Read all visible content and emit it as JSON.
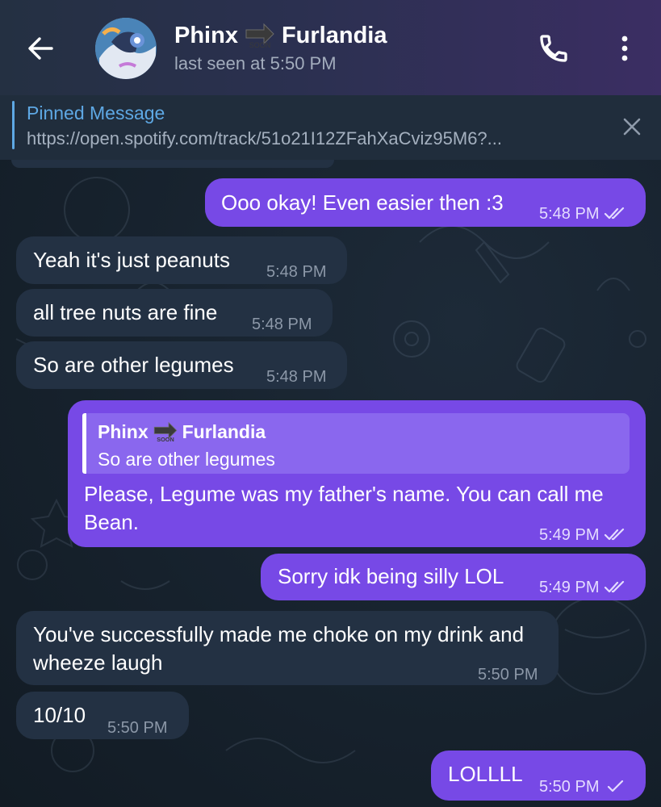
{
  "header": {
    "name_part1": "Phinx",
    "name_part2": "Furlandia",
    "soon_badge": "SOON",
    "status": "last seen at 5:50 PM"
  },
  "pinned": {
    "title": "Pinned Message",
    "text": "https://open.spotify.com/track/51o21I12ZFahXaCviz95M6?..."
  },
  "messages": [
    {
      "id": 1,
      "direction": "out",
      "text": "Ooo okay! Even easier then :3",
      "time": "5:48 PM",
      "status": "read"
    },
    {
      "id": 2,
      "direction": "in",
      "text": "Yeah it's just peanuts",
      "time": "5:48 PM"
    },
    {
      "id": 3,
      "direction": "in",
      "text": "all tree nuts are fine",
      "time": "5:48 PM"
    },
    {
      "id": 4,
      "direction": "in",
      "text": "So are other legumes",
      "time": "5:48 PM"
    },
    {
      "id": 5,
      "direction": "out",
      "reply_to": {
        "name_part1": "Phinx",
        "name_part2": "Furlandia",
        "soon_badge": "SOON",
        "text": "So are other legumes"
      },
      "text": "Please, Legume was my father's name. You can call me Bean.",
      "time": "5:49 PM",
      "status": "read"
    },
    {
      "id": 6,
      "direction": "out",
      "text": "Sorry idk being silly LOL",
      "time": "5:49 PM",
      "status": "read"
    },
    {
      "id": 7,
      "direction": "in",
      "text": "You've successfully made me choke on my drink and wheeze laugh",
      "time": "5:50 PM"
    },
    {
      "id": 8,
      "direction": "in",
      "text": "10/10",
      "time": "5:50 PM"
    },
    {
      "id": 9,
      "direction": "out",
      "text": "LOLLLL",
      "time": "5:50 PM",
      "status": "sent"
    }
  ],
  "colors": {
    "header_gradient_start": "#243042",
    "header_gradient_end": "#3b2e63",
    "incoming_bubble": "#233143",
    "outgoing_bubble": "#7749e6",
    "pinned_accent": "#5ea8e4",
    "background": "#15202b"
  },
  "icons": {
    "back": "arrow-left-icon",
    "call": "phone-icon",
    "menu": "more-vertical-icon",
    "pinned_close": "close-icon",
    "read_status": "double-check-icon",
    "sent_status": "single-check-icon",
    "soon": "soon-arrow-icon"
  }
}
